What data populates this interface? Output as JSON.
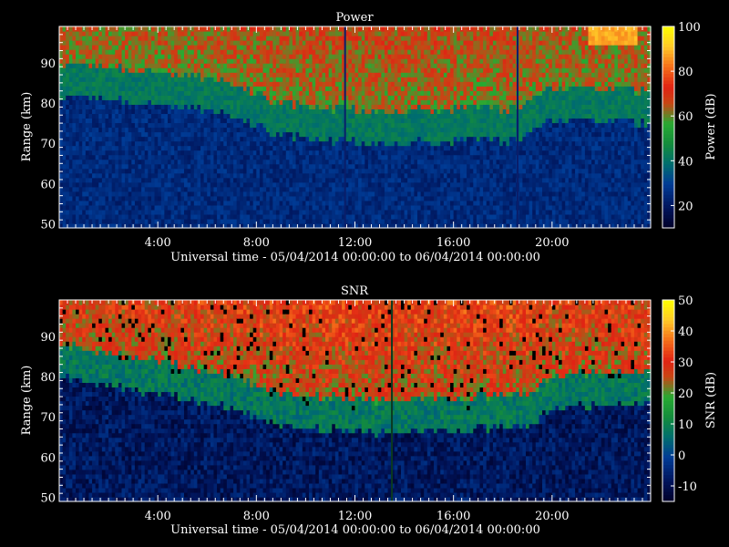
{
  "chart_data": [
    {
      "type": "heatmap",
      "title": "Power",
      "xlabel": "Universal time - 05/04/2014 00:00:00 to 06/04/2014 00:00:00",
      "ylabel": "Range (km)",
      "colorbar_label": "Power (dB)",
      "x_ticks": [
        "4:00",
        "8:00",
        "12:00",
        "16:00",
        "20:00"
      ],
      "x_tick_hours": [
        4,
        8,
        12,
        16,
        20
      ],
      "xlim_hours": [
        0,
        24
      ],
      "y_ticks": [
        "50",
        "60",
        "70",
        "80",
        "90"
      ],
      "y_tick_values": [
        50,
        60,
        70,
        80,
        90
      ],
      "ylim": [
        49,
        99
      ],
      "colorbar_ticks": [
        "20",
        "40",
        "60",
        "80",
        "100"
      ],
      "colorbar_tick_values": [
        20,
        40,
        60,
        80,
        100
      ],
      "clim": [
        10,
        100
      ],
      "colormap": "blue-green-red-yellow",
      "boundary_km": [
        [
          0,
          84
        ],
        [
          6.5,
          80
        ],
        [
          9,
          74
        ],
        [
          13,
          72
        ],
        [
          18.5,
          73
        ],
        [
          20,
          78
        ],
        [
          24,
          77
        ]
      ],
      "features": {
        "low_region_value": 25,
        "mid_region_value": 42,
        "top_region_value": 60,
        "yellow_patch": {
          "t_start": 21.5,
          "t_end": 23.5,
          "range_min": 94,
          "value": 88
        },
        "vertical_lines_hours": [
          11.6,
          18.6
        ]
      }
    },
    {
      "type": "heatmap",
      "title": "SNR",
      "xlabel": "Universal time - 05/04/2014 00:00:00 to 06/04/2014 00:00:00",
      "ylabel": "Range (km)",
      "colorbar_label": "SNR (dB)",
      "x_ticks": [
        "4:00",
        "8:00",
        "12:00",
        "16:00",
        "20:00"
      ],
      "x_tick_hours": [
        4,
        8,
        12,
        16,
        20
      ],
      "xlim_hours": [
        0,
        24
      ],
      "y_ticks": [
        "50",
        "60",
        "70",
        "80",
        "90"
      ],
      "y_tick_values": [
        50,
        60,
        70,
        80,
        90
      ],
      "ylim": [
        49,
        99
      ],
      "colorbar_ticks": [
        "-10",
        "0",
        "10",
        "20",
        "30",
        "40",
        "50"
      ],
      "colorbar_tick_values": [
        -10,
        0,
        10,
        20,
        30,
        40,
        50
      ],
      "clim": [
        -15,
        50
      ],
      "colormap": "blue-green-red-yellow",
      "boundary_km": [
        [
          0,
          82
        ],
        [
          4,
          78
        ],
        [
          6.5,
          75
        ],
        [
          9,
          70
        ],
        [
          13,
          68
        ],
        [
          19,
          70
        ],
        [
          20,
          74
        ],
        [
          24,
          76
        ]
      ],
      "features": {
        "low_region_value": -8,
        "mid_region_value": 8,
        "top_region_value": 24,
        "vertical_lines_hours": [
          13.5
        ]
      }
    }
  ]
}
